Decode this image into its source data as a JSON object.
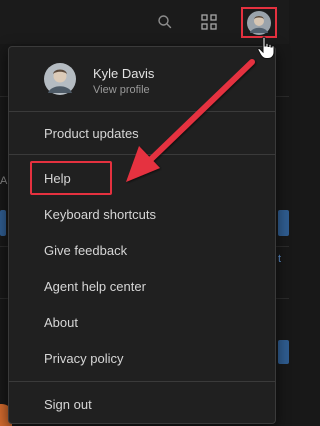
{
  "topbar": {
    "icons": [
      "search-icon",
      "apps-grid-icon",
      "avatar-icon"
    ]
  },
  "menu": {
    "user_name": "Kyle Davis",
    "user_sub": "View profile",
    "items": [
      {
        "label": "Product updates"
      },
      {
        "label": "Help"
      },
      {
        "label": "Keyboard shortcuts"
      },
      {
        "label": "Give feedback"
      },
      {
        "label": "Agent help center"
      },
      {
        "label": "About"
      },
      {
        "label": "Privacy policy"
      },
      {
        "label": "Sign out"
      }
    ]
  },
  "background": {
    "glyphs": [
      "A",
      "t"
    ]
  },
  "annotations": {
    "color": "#e5313f"
  }
}
